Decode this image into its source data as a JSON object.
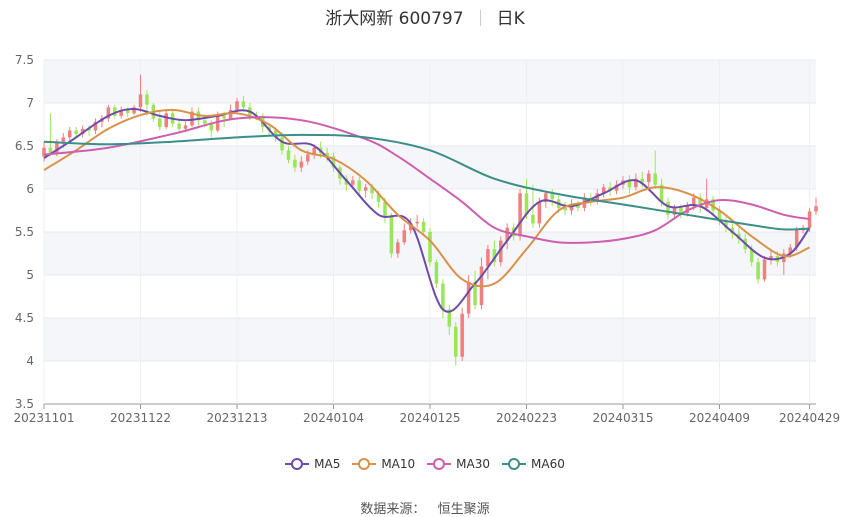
{
  "title": {
    "name": "浙大网新 600797",
    "period": "日K"
  },
  "source": {
    "label": "数据来源：",
    "value": "恒生聚源"
  },
  "colors": {
    "up": "#F08080",
    "down": "#9AE65A",
    "ma5": "#6F4BA8",
    "ma10": "#D9914A",
    "ma30": "#CC5FAE",
    "ma60": "#3C8E8A"
  },
  "chart_data": {
    "type": "candlestick",
    "ylim": [
      3.5,
      7.5
    ],
    "yticks": [
      "3.5",
      "4",
      "4.5",
      "5",
      "5.5",
      "6",
      "6.5",
      "7",
      "7.5"
    ],
    "xticks": [
      "20231101",
      "20231122",
      "20231213",
      "20240104",
      "20240125",
      "20240223",
      "20240315",
      "20240409",
      "20240429"
    ],
    "xtick_index": [
      0,
      15,
      30,
      45,
      60,
      75,
      90,
      105,
      119
    ],
    "grid": true,
    "legend_position": "bottom",
    "candles": [
      [
        6.38,
        6.48,
        6.32,
        6.55
      ],
      [
        6.48,
        6.42,
        6.38,
        6.88
      ],
      [
        6.42,
        6.55,
        6.38,
        6.58
      ],
      [
        6.55,
        6.6,
        6.48,
        6.65
      ],
      [
        6.6,
        6.68,
        6.55,
        6.72
      ],
      [
        6.68,
        6.64,
        6.6,
        6.72
      ],
      [
        6.64,
        6.7,
        6.6,
        6.74
      ],
      [
        6.7,
        6.68,
        6.62,
        6.74
      ],
      [
        6.68,
        6.78,
        6.64,
        6.82
      ],
      [
        6.78,
        6.82,
        6.72,
        6.86
      ],
      [
        6.82,
        6.95,
        6.78,
        6.98
      ],
      [
        6.95,
        6.85,
        6.82,
        6.98
      ],
      [
        6.85,
        6.92,
        6.82,
        6.96
      ],
      [
        6.92,
        6.88,
        6.84,
        6.95
      ],
      [
        6.88,
        6.95,
        6.86,
        6.98
      ],
      [
        6.95,
        7.1,
        6.9,
        7.33
      ],
      [
        7.1,
        6.98,
        6.85,
        7.15
      ],
      [
        6.98,
        6.82,
        6.78,
        7.0
      ],
      [
        6.82,
        6.72,
        6.68,
        6.9
      ],
      [
        6.72,
        6.88,
        6.7,
        6.92
      ],
      [
        6.88,
        6.76,
        6.72,
        6.92
      ],
      [
        6.76,
        6.7,
        6.66,
        6.8
      ],
      [
        6.7,
        6.74,
        6.66,
        6.78
      ],
      [
        6.74,
        6.9,
        6.72,
        6.95
      ],
      [
        6.9,
        6.8,
        6.74,
        6.95
      ],
      [
        6.8,
        6.76,
        6.72,
        6.84
      ],
      [
        6.76,
        6.68,
        6.6,
        6.8
      ],
      [
        6.68,
        6.85,
        6.66,
        6.9
      ],
      [
        6.85,
        6.82,
        6.72,
        6.9
      ],
      [
        6.82,
        6.92,
        6.8,
        6.98
      ],
      [
        6.92,
        7.02,
        6.88,
        7.06
      ],
      [
        7.02,
        6.95,
        6.9,
        7.08
      ],
      [
        6.95,
        6.86,
        6.8,
        7.0
      ],
      [
        6.86,
        6.85,
        6.8,
        6.9
      ],
      [
        6.85,
        6.72,
        6.66,
        6.88
      ],
      [
        6.72,
        6.68,
        6.62,
        6.76
      ],
      [
        6.68,
        6.6,
        6.55,
        6.72
      ],
      [
        6.6,
        6.45,
        6.4,
        6.66
      ],
      [
        6.45,
        6.34,
        6.3,
        6.5
      ],
      [
        6.34,
        6.25,
        6.2,
        6.4
      ],
      [
        6.25,
        6.32,
        6.2,
        6.38
      ],
      [
        6.32,
        6.4,
        6.28,
        6.45
      ],
      [
        6.4,
        6.48,
        6.35,
        6.52
      ],
      [
        6.48,
        6.42,
        6.36,
        6.55
      ],
      [
        6.42,
        6.38,
        6.32,
        6.48
      ],
      [
        6.38,
        6.25,
        6.2,
        6.42
      ],
      [
        6.25,
        6.12,
        6.05,
        6.28
      ],
      [
        6.12,
        6.05,
        5.98,
        6.16
      ],
      [
        6.05,
        6.1,
        6.0,
        6.15
      ],
      [
        6.1,
        5.98,
        5.92,
        6.14
      ],
      [
        5.98,
        6.02,
        5.9,
        6.06
      ],
      [
        6.02,
        5.95,
        5.88,
        6.06
      ],
      [
        5.95,
        5.85,
        5.78,
        5.98
      ],
      [
        5.85,
        5.68,
        5.6,
        5.9
      ],
      [
        5.68,
        5.25,
        5.2,
        5.72
      ],
      [
        5.25,
        5.38,
        5.2,
        5.42
      ],
      [
        5.38,
        5.52,
        5.35,
        5.6
      ],
      [
        5.52,
        5.6,
        5.48,
        5.66
      ],
      [
        5.6,
        5.62,
        5.55,
        5.7
      ],
      [
        5.62,
        5.5,
        5.45,
        5.66
      ],
      [
        5.5,
        5.15,
        5.1,
        5.55
      ],
      [
        5.15,
        4.9,
        4.85,
        5.18
      ],
      [
        4.9,
        4.6,
        4.5,
        4.95
      ],
      [
        4.6,
        4.4,
        4.3,
        4.65
      ],
      [
        4.4,
        4.05,
        3.95,
        4.45
      ],
      [
        4.05,
        4.55,
        4.0,
        4.62
      ],
      [
        4.55,
        4.92,
        4.5,
        5.0
      ],
      [
        4.92,
        4.65,
        4.6,
        5.05
      ],
      [
        4.65,
        5.1,
        4.6,
        5.2
      ],
      [
        5.1,
        5.3,
        4.95,
        5.35
      ],
      [
        5.3,
        5.15,
        5.1,
        5.4
      ],
      [
        5.15,
        5.4,
        5.1,
        5.45
      ],
      [
        5.4,
        5.55,
        5.3,
        5.6
      ],
      [
        5.55,
        5.45,
        5.4,
        5.6
      ],
      [
        5.45,
        5.95,
        5.4,
        6.0
      ],
      [
        5.95,
        5.7,
        5.65,
        6.12
      ],
      [
        5.7,
        5.6,
        5.55,
        6.05
      ],
      [
        5.6,
        5.85,
        5.55,
        5.9
      ],
      [
        5.85,
        5.95,
        5.78,
        5.98
      ],
      [
        5.95,
        5.88,
        5.8,
        6.0
      ],
      [
        5.88,
        5.78,
        5.72,
        5.92
      ],
      [
        5.78,
        5.75,
        5.7,
        5.85
      ],
      [
        5.75,
        5.82,
        5.7,
        5.88
      ],
      [
        5.82,
        5.78,
        5.74,
        5.86
      ],
      [
        5.78,
        5.9,
        5.74,
        5.95
      ],
      [
        5.9,
        5.85,
        5.8,
        5.95
      ],
      [
        5.85,
        5.95,
        5.82,
        6.0
      ],
      [
        5.95,
        6.02,
        5.9,
        6.06
      ],
      [
        6.02,
        5.98,
        5.92,
        6.08
      ],
      [
        5.98,
        6.05,
        5.94,
        6.1
      ],
      [
        6.05,
        6.1,
        6.0,
        6.15
      ],
      [
        6.1,
        6.02,
        5.95,
        6.16
      ],
      [
        6.02,
        6.12,
        5.98,
        6.18
      ],
      [
        6.12,
        6.08,
        6.02,
        6.2
      ],
      [
        6.08,
        6.18,
        6.02,
        6.22
      ],
      [
        6.18,
        6.05,
        6.0,
        6.45
      ],
      [
        6.05,
        5.85,
        5.8,
        6.12
      ],
      [
        5.85,
        5.7,
        5.65,
        5.9
      ],
      [
        5.7,
        5.78,
        5.65,
        5.82
      ],
      [
        5.78,
        5.72,
        5.66,
        5.82
      ],
      [
        5.72,
        5.8,
        5.68,
        5.85
      ],
      [
        5.8,
        5.9,
        5.75,
        5.95
      ],
      [
        5.9,
        5.78,
        5.72,
        5.95
      ],
      [
        5.78,
        5.88,
        5.74,
        6.12
      ],
      [
        5.88,
        5.75,
        5.7,
        5.92
      ],
      [
        5.75,
        5.62,
        5.58,
        5.8
      ],
      [
        5.62,
        5.55,
        5.5,
        5.68
      ],
      [
        5.55,
        5.48,
        5.42,
        5.6
      ],
      [
        5.48,
        5.42,
        5.36,
        5.55
      ],
      [
        5.42,
        5.3,
        5.25,
        5.48
      ],
      [
        5.3,
        5.15,
        5.1,
        5.35
      ],
      [
        5.15,
        4.95,
        4.9,
        5.2
      ],
      [
        4.95,
        5.18,
        4.92,
        5.22
      ],
      [
        5.18,
        5.22,
        5.12,
        5.28
      ],
      [
        5.22,
        5.15,
        5.1,
        5.28
      ],
      [
        5.15,
        5.25,
        5.0,
        5.3
      ],
      [
        5.25,
        5.32,
        5.2,
        5.36
      ],
      [
        5.32,
        5.52,
        5.28,
        5.56
      ],
      [
        5.52,
        5.55,
        5.48,
        5.58
      ],
      [
        5.55,
        5.74,
        5.5,
        5.78
      ],
      [
        5.74,
        5.8,
        5.7,
        5.9
      ]
    ],
    "series": [
      {
        "name": "MA5",
        "key": "ma5",
        "x": [
          0,
          4,
          10,
          14,
          18,
          22,
          27,
          32,
          37,
          42,
          47,
          52,
          57,
          62,
          67,
          72,
          77,
          82,
          87,
          92,
          97,
          102,
          107,
          112,
          116,
          119
        ],
        "values": [
          6.36,
          6.55,
          6.85,
          6.93,
          6.85,
          6.8,
          6.85,
          6.9,
          6.55,
          6.5,
          6.1,
          5.7,
          5.6,
          4.6,
          4.9,
          5.4,
          5.85,
          5.8,
          5.95,
          6.1,
          5.8,
          5.8,
          5.5,
          5.2,
          5.25,
          5.55
        ]
      },
      {
        "name": "MA10",
        "key": "ma10",
        "x": [
          0,
          5,
          10,
          15,
          20,
          25,
          30,
          35,
          40,
          45,
          50,
          55,
          60,
          65,
          70,
          75,
          80,
          85,
          90,
          95,
          100,
          105,
          110,
          115,
          119
        ],
        "values": [
          6.22,
          6.45,
          6.7,
          6.86,
          6.92,
          6.85,
          6.88,
          6.75,
          6.45,
          6.35,
          6.1,
          5.7,
          5.4,
          4.95,
          4.9,
          5.3,
          5.75,
          5.85,
          5.9,
          6.02,
          5.95,
          5.75,
          5.45,
          5.22,
          5.32
        ]
      },
      {
        "name": "MA30",
        "key": "ma30",
        "x": [
          0,
          10,
          20,
          30,
          40,
          50,
          55,
          60,
          65,
          70,
          75,
          80,
          85,
          90,
          95,
          100,
          105,
          110,
          115,
          119
        ],
        "values": [
          6.4,
          6.48,
          6.64,
          6.82,
          6.8,
          6.58,
          6.38,
          6.12,
          5.85,
          5.55,
          5.45,
          5.38,
          5.38,
          5.42,
          5.52,
          5.75,
          5.87,
          5.82,
          5.7,
          5.65
        ]
      },
      {
        "name": "MA60",
        "key": "ma60",
        "x": [
          0,
          10,
          20,
          30,
          40,
          50,
          60,
          70,
          80,
          90,
          100,
          110,
          115,
          119
        ],
        "values": [
          6.55,
          6.52,
          6.55,
          6.6,
          6.63,
          6.6,
          6.45,
          6.12,
          5.94,
          5.82,
          5.7,
          5.58,
          5.53,
          5.54
        ]
      }
    ]
  }
}
